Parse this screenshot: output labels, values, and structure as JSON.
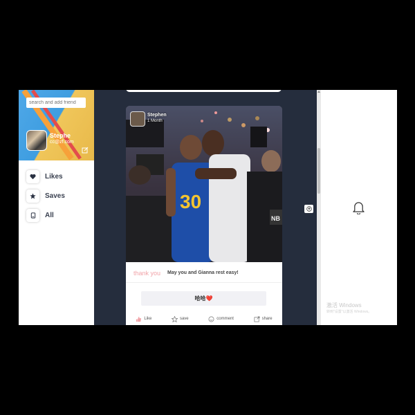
{
  "search": {
    "placeholder": "search and add friend"
  },
  "profile": {
    "name": "Stephe",
    "email": "cc@zf.com"
  },
  "nav": [
    {
      "label": "Likes",
      "icon": "heart-icon"
    },
    {
      "label": "Saves",
      "icon": "star-icon"
    },
    {
      "label": "All",
      "icon": "document-icon"
    }
  ],
  "post": {
    "author": "Stephen",
    "time": "1 Month",
    "tag": "thank you",
    "caption": "May you and Gianna rest easy!",
    "comment": "哈哈❤️",
    "actions": [
      {
        "label": "Like",
        "icon": "thumbs-up-icon"
      },
      {
        "label": "save",
        "icon": "star-outline-icon"
      },
      {
        "label": "comment",
        "icon": "comment-icon"
      },
      {
        "label": "share",
        "icon": "share-icon"
      }
    ]
  },
  "watermark": {
    "line1": "激活 Windows",
    "line2": "转到\"设置\"以激活 Windows。"
  },
  "colors": {
    "background": "#252d3d",
    "tag": "#f1a3a8",
    "accent": "#3a4150"
  }
}
